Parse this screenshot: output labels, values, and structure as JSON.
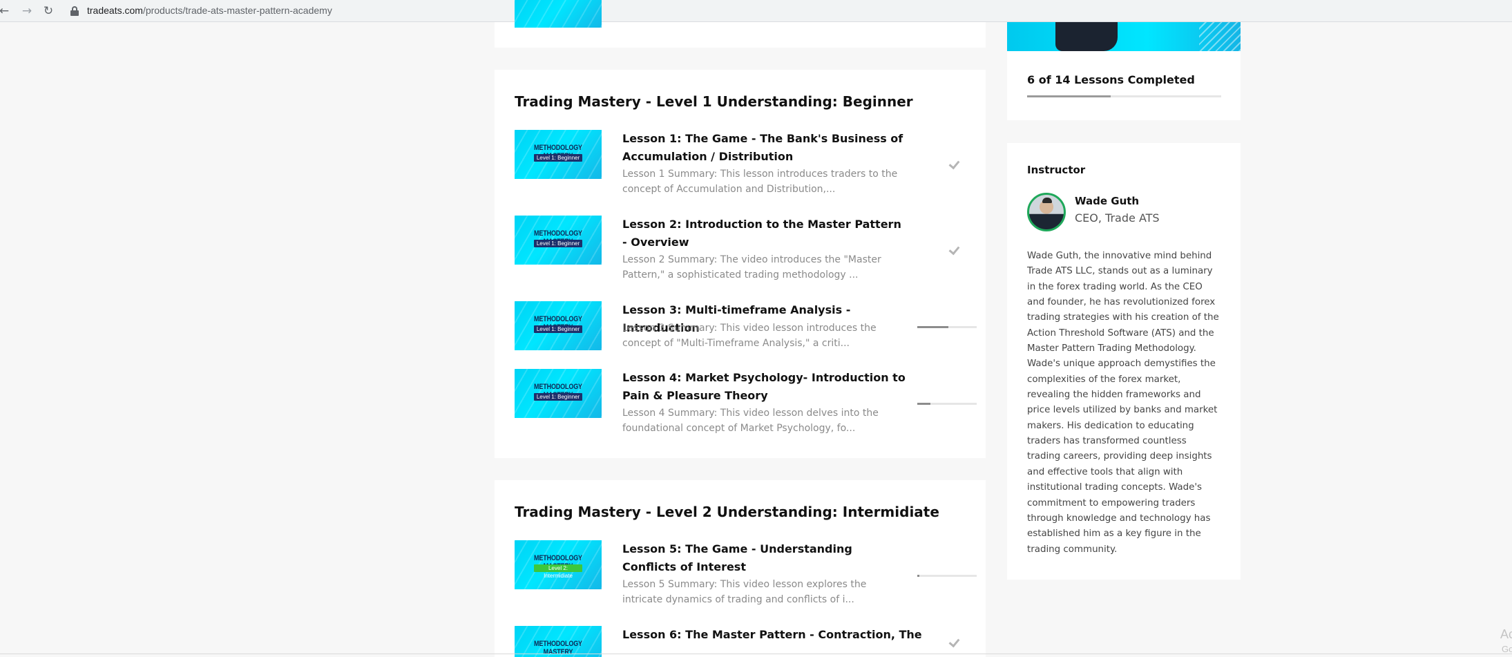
{
  "browser": {
    "url_domain": "tradeats.com",
    "url_path": "/products/trade-ats-master-pattern-academy"
  },
  "sections": [
    {
      "title": "Trading Mastery - Level 1 Understanding: Beginner",
      "lessons": [
        {
          "title": "Lesson 1: The Game - The Bank's Business of Accumulation / Distribution",
          "summary": "Lesson 1 Summary: This lesson introduces traders to the concept of Accumulation and Distribution,...",
          "thumb_title": "METHODOLOGY MASTERY",
          "thumb_badge": "Level 1: Beginner",
          "status": "completed"
        },
        {
          "title": "Lesson 2: Introduction to the Master Pattern - Overview",
          "summary": "Lesson 2 Summary: The video introduces the \"Master Pattern,\" a sophisticated trading methodology ...",
          "thumb_title": "METHODOLOGY MASTERY",
          "thumb_badge": "Level 1: Beginner",
          "status": "completed"
        },
        {
          "title": "Lesson 3: Multi-timeframe Analysis - Introduction",
          "summary": "Lesson 3 Summary: This video lesson introduces the concept of \"Multi-Timeframe Analysis,\" a criti...",
          "thumb_title": "METHODOLOGY MASTERY",
          "thumb_badge": "Level 1: Beginner",
          "status": "in_progress",
          "progress": 0.52
        },
        {
          "title": "Lesson 4: Market Psychology- Introduction to Pain & Pleasure Theory",
          "summary": "Lesson 4 Summary: This video lesson delves into the foundational concept of Market Psychology, fo...",
          "thumb_title": "METHODOLOGY MASTERY",
          "thumb_badge": "Level 1: Beginner",
          "status": "in_progress",
          "progress": 0.22
        }
      ]
    },
    {
      "title": "Trading Mastery - Level 2 Understanding: Intermidiate",
      "lessons": [
        {
          "title": "Lesson 5: The Game - Understanding Conflicts of Interest",
          "summary": "Lesson 5 Summary: This video lesson explores the intricate dynamics of trading and conflicts of i...",
          "thumb_title": "METHODOLOGY MASTERY",
          "thumb_badge": "Level 2: Intermidiate",
          "status": "in_progress",
          "progress": 0.03
        },
        {
          "title": "Lesson 6: The Master Pattern - Contraction, The",
          "thumb_title": "METHODOLOGY MASTERY",
          "status": "completed"
        }
      ]
    }
  ],
  "progress_card": {
    "label": "6 of 14 Lessons Completed",
    "fraction": 0.43
  },
  "instructor": {
    "heading": "Instructor",
    "name": "Wade Guth",
    "role": "CEO, Trade ATS",
    "bio": "Wade Guth, the innovative mind behind Trade ATS LLC, stands out as a luminary in the forex trading world. As the CEO and founder, he has revolutionized forex trading strategies with his creation of the Action Threshold Software (ATS) and the Master Pattern Trading Methodology. Wade's unique approach demystifies the complexities of the forex market, revealing the hidden frameworks and price levels utilized by banks and market makers. His dedication to educating traders has transformed countless trading careers, providing deep insights and effective tools that align with institutional trading concepts. Wade's commitment to empowering traders through knowledge and technology has established him as a key figure in the trading community."
  },
  "watermark": {
    "line1": "Ac",
    "line2": "Go"
  }
}
